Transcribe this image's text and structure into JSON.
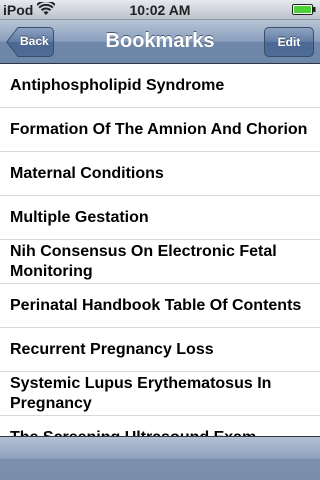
{
  "status_bar": {
    "carrier": "iPod",
    "time": "10:02 AM",
    "wifi_icon": "wifi-icon",
    "battery_icon": "battery-icon"
  },
  "nav_bar": {
    "title": "Bookmarks",
    "back_label": "Back",
    "edit_label": "Edit"
  },
  "bookmarks": [
    "Antiphospholipid Syndrome",
    "Formation Of The Amnion And Chorion",
    "Maternal Conditions",
    "Multiple Gestation",
    "Nih Consensus On Electronic Fetal Monitoring",
    "Perinatal Handbook Table Of Contents",
    "Recurrent Pregnancy Loss",
    "Systemic Lupus Erythematosus In Pregnancy",
    "The Screening Ultrasound Exam"
  ],
  "colors": {
    "nav_bar": "#7b92b3",
    "toolbar": "#8799b4",
    "battery_fill": "#4cd137"
  }
}
